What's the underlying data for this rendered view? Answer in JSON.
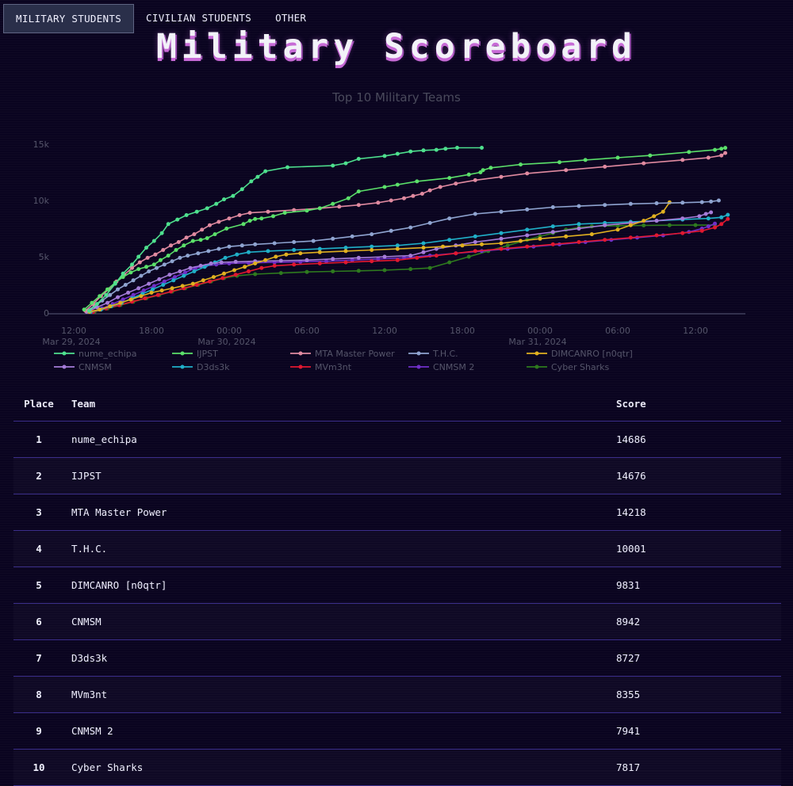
{
  "tabs": [
    "MILITARY STUDENTS",
    "CIVILIAN STUDENTS",
    "OTHER"
  ],
  "active_tab": 0,
  "page_title": "Military Scoreboard",
  "chart_data": {
    "type": "line",
    "title": "Top 10 Military Teams",
    "xlabel": "",
    "ylabel": "",
    "x_tick_labels": [
      "12:00\nMar 29, 2024",
      "18:00",
      "00:00\nMar 30, 2024",
      "06:00",
      "12:00",
      "18:00",
      "00:00\nMar 31, 2024",
      "06:00",
      "12:00"
    ],
    "y_tick_labels": [
      "0",
      "5k",
      "10k",
      "15k"
    ],
    "ylim": [
      0,
      16000
    ],
    "x_unit": "hours since first x tick (Mar 29, 2024 12:00)",
    "xlim": [
      -4.5,
      51
    ],
    "grid": false,
    "legend_position": "bottom",
    "series": [
      {
        "name": "nume_echipa",
        "color": "#4ee08e",
        "x": [
          1.2,
          1.8,
          2.5,
          3.2,
          3.8,
          4.5,
          5.0,
          5.6,
          6.2,
          6.8,
          7.3,
          8.0,
          8.7,
          9.5,
          10.3,
          11.0,
          11.6,
          12.3,
          13.0,
          13.7,
          14.2,
          14.8,
          16.5,
          20.0,
          21.0,
          22.0,
          24.0,
          25.0,
          26.0,
          27.0,
          28.0,
          28.7,
          29.6,
          31.5
        ],
        "y": [
          200,
          800,
          1600,
          2600,
          3500,
          4300,
          5000,
          5800,
          6400,
          7100,
          7900,
          8300,
          8700,
          9000,
          9300,
          9700,
          10100,
          10400,
          11000,
          11700,
          12100,
          12600,
          12950,
          13100,
          13300,
          13700,
          13950,
          14150,
          14350,
          14450,
          14500,
          14600,
          14680,
          14686
        ]
      },
      {
        "name": "IJPST",
        "color": "#5be06a",
        "x": [
          0.8,
          1.4,
          2.0,
          2.6,
          3.2,
          3.8,
          4.4,
          5.0,
          5.6,
          6.2,
          6.7,
          7.3,
          7.9,
          8.5,
          9.2,
          9.8,
          10.3,
          10.9,
          11.8,
          13.1,
          13.6,
          14.0,
          14.5,
          15.4,
          16.3,
          18.0,
          19.0,
          20.0,
          21.2,
          22.0,
          24.0,
          25.0,
          26.5,
          29.0,
          30.5,
          31.4,
          31.6,
          32.2,
          34.5,
          37.5,
          39.5,
          42.0,
          44.5,
          47.5,
          49.5,
          50.0,
          50.3
        ],
        "y": [
          300,
          900,
          1500,
          2100,
          2700,
          3200,
          3600,
          3900,
          4100,
          4300,
          4700,
          5100,
          5600,
          6000,
          6400,
          6500,
          6650,
          7000,
          7500,
          7900,
          8200,
          8350,
          8400,
          8600,
          8900,
          9100,
          9300,
          9700,
          10200,
          10800,
          11200,
          11400,
          11700,
          12000,
          12300,
          12500,
          12700,
          12900,
          13200,
          13400,
          13600,
          13800,
          14000,
          14300,
          14500,
          14600,
          14676
        ]
      },
      {
        "name": "MTA Master Power",
        "color": "#e08aa0",
        "x": [
          0.9,
          1.5,
          2.1,
          2.7,
          3.3,
          3.9,
          4.5,
          5.1,
          5.7,
          6.3,
          6.9,
          7.5,
          8.1,
          8.7,
          9.3,
          9.9,
          10.5,
          11.2,
          12.0,
          12.8,
          13.6,
          15.0,
          17.0,
          19.0,
          20.5,
          22.0,
          23.5,
          24.5,
          25.5,
          26.2,
          26.9,
          27.5,
          28.3,
          29.5,
          31.0,
          33.0,
          35.0,
          38.0,
          41.0,
          44.0,
          47.0,
          49.0,
          50.0,
          50.3
        ],
        "y": [
          200,
          800,
          1500,
          2100,
          2800,
          3400,
          4000,
          4500,
          4900,
          5200,
          5600,
          6000,
          6300,
          6700,
          7000,
          7400,
          7800,
          8100,
          8400,
          8700,
          8900,
          9000,
          9150,
          9300,
          9450,
          9600,
          9800,
          10000,
          10200,
          10400,
          10600,
          10900,
          11200,
          11500,
          11800,
          12100,
          12400,
          12700,
          13000,
          13300,
          13600,
          13800,
          14000,
          14218
        ]
      },
      {
        "name": "T.H.C.",
        "color": "#8fa4d0",
        "x": [
          1.0,
          1.6,
          2.2,
          2.8,
          3.4,
          4.0,
          4.6,
          5.2,
          5.8,
          6.4,
          7.0,
          7.6,
          8.2,
          8.8,
          9.6,
          10.4,
          11.2,
          12.0,
          13.0,
          14.0,
          15.5,
          17.0,
          18.5,
          20.0,
          21.5,
          23.0,
          24.5,
          26.0,
          27.5,
          29.0,
          31.0,
          33.0,
          35.0,
          37.0,
          39.0,
          41.0,
          43.0,
          45.0,
          47.0,
          48.5,
          49.2,
          49.8
        ],
        "y": [
          200,
          600,
          1100,
          1600,
          2100,
          2500,
          2900,
          3300,
          3700,
          4000,
          4300,
          4600,
          4900,
          5100,
          5300,
          5500,
          5700,
          5900,
          6000,
          6100,
          6200,
          6300,
          6400,
          6600,
          6800,
          7000,
          7300,
          7600,
          8000,
          8400,
          8800,
          9000,
          9200,
          9400,
          9500,
          9600,
          9700,
          9750,
          9800,
          9850,
          9900,
          10001
        ]
      },
      {
        "name": "DIMCANRO [n0qtr]",
        "color": "#e0b020",
        "x": [
          1.2,
          2.0,
          2.8,
          3.6,
          4.4,
          5.2,
          6.0,
          6.8,
          7.6,
          8.4,
          9.2,
          10.0,
          10.8,
          11.6,
          12.4,
          13.2,
          14.0,
          14.8,
          15.6,
          16.4,
          17.5,
          19.0,
          21.0,
          23.0,
          25.0,
          27.0,
          28.5,
          30.0,
          31.5,
          33.0,
          34.5,
          36.0,
          38.0,
          40.0,
          42.0,
          43.0,
          44.0,
          44.8,
          45.5,
          46.0
        ],
        "y": [
          100,
          300,
          600,
          900,
          1200,
          1500,
          1800,
          2000,
          2200,
          2400,
          2600,
          2900,
          3200,
          3500,
          3800,
          4100,
          4400,
          4700,
          5000,
          5200,
          5300,
          5400,
          5500,
          5600,
          5700,
          5800,
          5900,
          6000,
          6100,
          6200,
          6400,
          6600,
          6800,
          7000,
          7400,
          7800,
          8200,
          8600,
          9000,
          9831
        ]
      },
      {
        "name": "CNMSM",
        "color": "#a57cd8",
        "x": [
          1.0,
          1.8,
          2.6,
          3.4,
          4.2,
          5.0,
          5.8,
          6.6,
          7.4,
          8.2,
          9.0,
          9.8,
          10.6,
          11.4,
          12.5,
          14.0,
          16.0,
          18.0,
          20.0,
          22.0,
          24.0,
          26.0,
          27.0,
          28.0,
          29.5,
          31.0,
          33.0,
          35.0,
          37.0,
          39.0,
          41.0,
          43.0,
          45.0,
          47.0,
          48.3,
          48.8,
          49.2
        ],
        "y": [
          100,
          500,
          900,
          1400,
          1800,
          2200,
          2600,
          3000,
          3400,
          3700,
          4000,
          4200,
          4400,
          4500,
          4550,
          4600,
          4650,
          4700,
          4800,
          4900,
          5000,
          5100,
          5400,
          5700,
          6000,
          6300,
          6600,
          6900,
          7200,
          7500,
          7800,
          8000,
          8200,
          8400,
          8600,
          8800,
          8942
        ]
      },
      {
        "name": "D3ds3k",
        "color": "#20b0c8",
        "x": [
          1.3,
          2.1,
          2.9,
          3.7,
          4.5,
          5.3,
          6.1,
          6.9,
          7.7,
          8.5,
          9.3,
          10.1,
          10.9,
          11.7,
          12.6,
          13.5,
          15.0,
          17.0,
          19.0,
          21.0,
          23.0,
          25.0,
          27.0,
          29.0,
          31.0,
          33.0,
          35.0,
          37.0,
          39.0,
          41.0,
          43.0,
          45.0,
          47.0,
          49.0,
          50.0,
          50.5
        ],
        "y": [
          100,
          300,
          600,
          900,
          1300,
          1700,
          2100,
          2500,
          2900,
          3300,
          3700,
          4100,
          4500,
          4900,
          5200,
          5400,
          5500,
          5600,
          5700,
          5800,
          5900,
          6000,
          6200,
          6500,
          6800,
          7100,
          7400,
          7700,
          7900,
          8000,
          8100,
          8200,
          8300,
          8400,
          8500,
          8727
        ]
      },
      {
        "name": "MVm3nt",
        "color": "#e01830",
        "x": [
          1.5,
          2.5,
          3.5,
          4.5,
          5.5,
          6.5,
          7.5,
          8.5,
          9.5,
          10.5,
          11.5,
          12.5,
          13.5,
          14.5,
          15.5,
          17.0,
          19.0,
          21.0,
          23.0,
          25.0,
          26.5,
          28.0,
          29.5,
          31.0,
          33.0,
          35.0,
          37.0,
          39.0,
          41.0,
          43.0,
          45.0,
          47.0,
          48.5,
          49.5,
          50.0,
          50.5
        ],
        "y": [
          100,
          400,
          700,
          1000,
          1300,
          1600,
          1900,
          2200,
          2500,
          2800,
          3100,
          3400,
          3700,
          4000,
          4200,
          4300,
          4400,
          4500,
          4600,
          4700,
          4900,
          5100,
          5300,
          5500,
          5700,
          5900,
          6100,
          6300,
          6500,
          6700,
          6900,
          7100,
          7300,
          7600,
          7900,
          8355
        ]
      },
      {
        "name": "CNMSM 2",
        "color": "#7030c8",
        "x": [
          1.4,
          2.2,
          3.0,
          3.8,
          4.6,
          5.4,
          6.2,
          7.0,
          7.8,
          8.6,
          9.4,
          10.2,
          11.0,
          12.0,
          13.5,
          15.5,
          17.5,
          19.5,
          21.5,
          23.5,
          25.5,
          27.5,
          29.5,
          31.5,
          33.5,
          35.5,
          37.5,
          39.5,
          41.5,
          43.5,
          45.5,
          47.5,
          48.5,
          49.0,
          49.5
        ],
        "y": [
          100,
          400,
          800,
          1200,
          1600,
          2000,
          2400,
          2800,
          3200,
          3600,
          4000,
          4200,
          4300,
          4400,
          4450,
          4500,
          4550,
          4600,
          4700,
          4800,
          4900,
          5100,
          5300,
          5500,
          5700,
          5900,
          6100,
          6300,
          6500,
          6700,
          6900,
          7200,
          7500,
          7700,
          7941
        ]
      },
      {
        "name": "Cyber Sharks",
        "color": "#2e7a1e",
        "x": [
          1.6,
          2.6,
          3.6,
          4.6,
          5.6,
          6.6,
          7.6,
          8.6,
          9.6,
          10.6,
          11.6,
          12.6,
          14.0,
          16.0,
          18.0,
          20.0,
          22.0,
          24.0,
          26.0,
          27.5,
          29.0,
          30.5,
          32.0,
          33.5,
          35.0,
          36.0,
          37.0,
          38.0,
          39.0,
          40.0,
          42.0,
          44.0,
          46.0,
          48.0,
          49.5
        ],
        "y": [
          100,
          400,
          700,
          1000,
          1300,
          1600,
          1900,
          2200,
          2500,
          2800,
          3100,
          3300,
          3450,
          3550,
          3650,
          3700,
          3750,
          3800,
          3900,
          4000,
          4500,
          5000,
          5500,
          6000,
          6500,
          6800,
          7100,
          7400,
          7600,
          7700,
          7750,
          7780,
          7800,
          7810,
          7817
        ]
      }
    ]
  },
  "table": {
    "headers": {
      "place": "Place",
      "team": "Team",
      "score": "Score"
    },
    "rows": [
      {
        "place": "1",
        "team": "nume_echipa",
        "score": "14686"
      },
      {
        "place": "2",
        "team": "IJPST",
        "score": "14676"
      },
      {
        "place": "3",
        "team": "MTA Master Power",
        "score": "14218"
      },
      {
        "place": "4",
        "team": "T.H.C.",
        "score": "10001"
      },
      {
        "place": "5",
        "team": "DIMCANRO [n0qtr]",
        "score": "9831"
      },
      {
        "place": "6",
        "team": "CNMSM",
        "score": "8942"
      },
      {
        "place": "7",
        "team": "D3ds3k",
        "score": "8727"
      },
      {
        "place": "8",
        "team": "MVm3nt",
        "score": "8355"
      },
      {
        "place": "9",
        "team": "CNMSM 2",
        "score": "7941"
      },
      {
        "place": "10",
        "team": "Cyber Sharks",
        "score": "7817"
      }
    ]
  }
}
